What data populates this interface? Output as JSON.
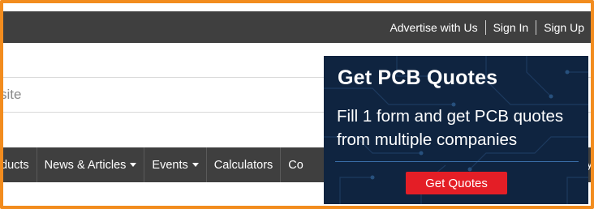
{
  "header": {
    "links": [
      "Advertise with Us",
      "Sign In",
      "Sign Up"
    ]
  },
  "search": {
    "partial_text": "site"
  },
  "nav": {
    "items": [
      {
        "label": "ducts",
        "dropdown": false
      },
      {
        "label": "News & Articles",
        "dropdown": true
      },
      {
        "label": "Events",
        "dropdown": true
      },
      {
        "label": "Calculators",
        "dropdown": false
      },
      {
        "label": "Co",
        "dropdown": false
      }
    ],
    "end_fragment": "y"
  },
  "ad": {
    "title": "Get PCB Quotes",
    "body": "Fill 1 form and get PCB quotes from multiple companies",
    "button": "Get Quotes"
  },
  "colors": {
    "frame": "#f28c1e",
    "bar": "#3f3f3f",
    "ad_bg": "#0f2440",
    "ad_button": "#e41e26"
  }
}
